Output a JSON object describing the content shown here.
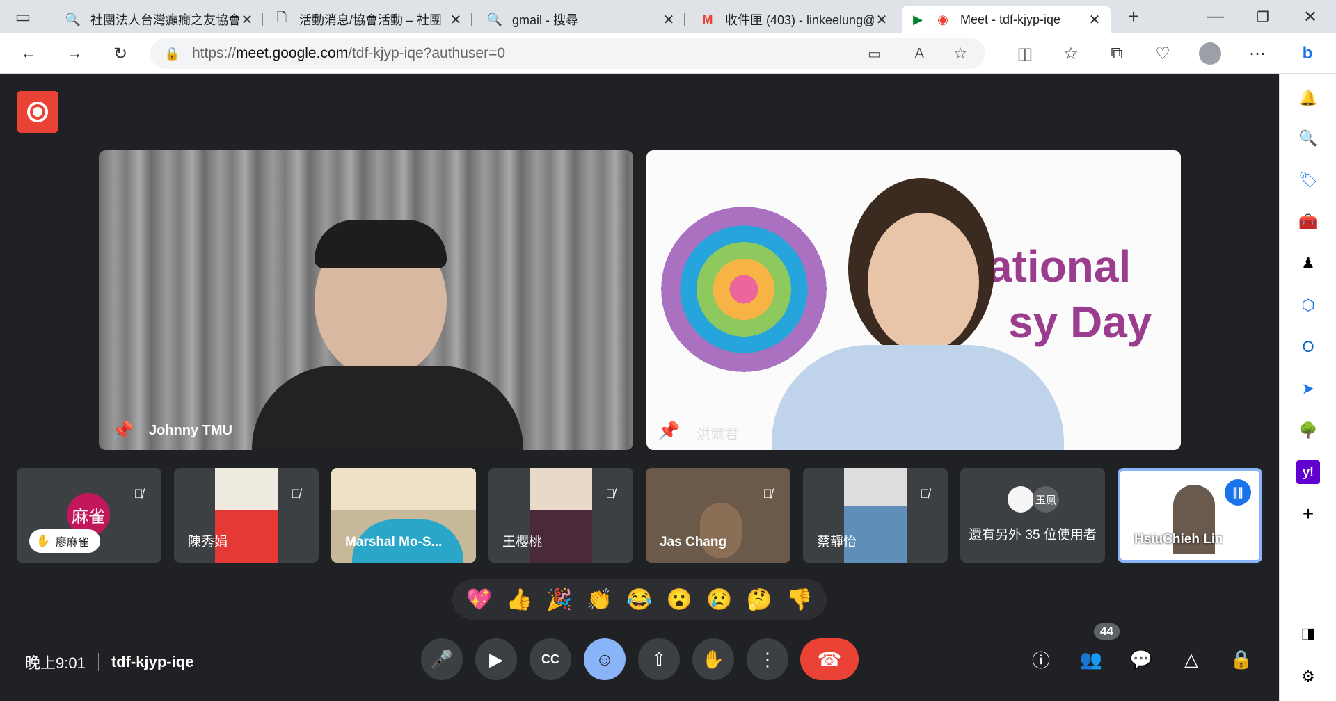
{
  "browser": {
    "tabs": [
      {
        "title": "社團法人台灣癲癇之友協會",
        "icon": "search-icon"
      },
      {
        "title": "活動消息/協會活動 – 社團",
        "icon": "document-icon"
      },
      {
        "title": "gmail - 搜尋",
        "icon": "search-icon"
      },
      {
        "title": "收件匣 (403) - linkeelung@",
        "icon": "gmail-icon"
      },
      {
        "title": "Meet - tdf-kjyp-iqe",
        "icon": "meet-icon"
      }
    ],
    "url_prefix": "https://",
    "url_host": "meet.google.com",
    "url_path": "/tdf-kjyp-iqe?authuser=0"
  },
  "meet": {
    "main_tiles": [
      {
        "name": "Johnny TMU"
      },
      {
        "name": "洪爾君",
        "banner_text": "ational",
        "banner_text2": "sy Day"
      }
    ],
    "small_tiles": [
      {
        "name": "廖麻雀",
        "avatar_text": "麻雀",
        "hand_raised": true
      },
      {
        "name": "陳秀娟"
      },
      {
        "name": "Marshal Mo-S..."
      },
      {
        "name": "王櫻桃"
      },
      {
        "name": "Jas Chang"
      },
      {
        "name": "蔡靜怡"
      },
      {
        "name": "還有另外 35 位使用者",
        "avatar_text": "玉鳳"
      },
      {
        "name": "HsiuChieh Lin"
      }
    ],
    "reactions": [
      "💖",
      "👍",
      "🎉",
      "👏",
      "😂",
      "😮",
      "😢",
      "🤔",
      "👎"
    ],
    "time": "晚上9:01",
    "meeting_code": "tdf-kjyp-iqe",
    "participant_count": "44",
    "colors": {
      "accent": "#8ab4f8",
      "end_call": "#ea4335",
      "record": "#ea4335"
    }
  }
}
